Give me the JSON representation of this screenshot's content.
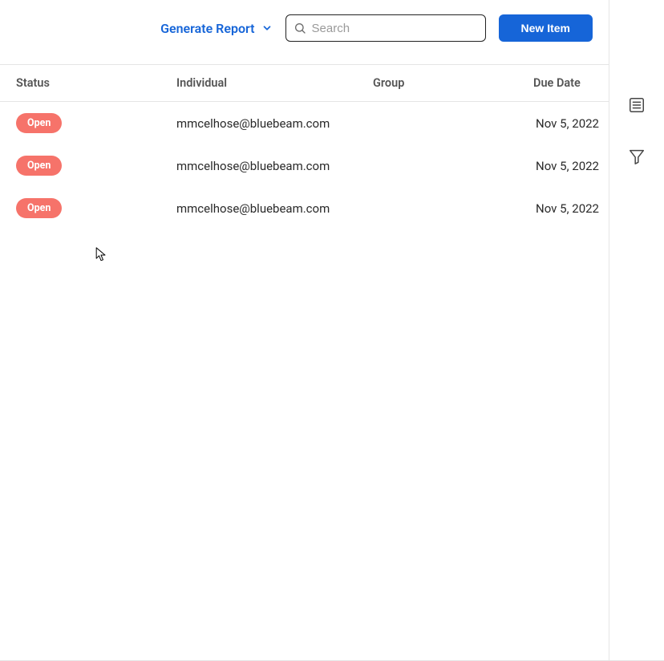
{
  "toolbar": {
    "generate_report_label": "Generate Report",
    "search_placeholder": "Search",
    "new_item_label": "New Item"
  },
  "columns": {
    "status": "Status",
    "individual": "Individual",
    "group": "Group",
    "due_date": "Due Date"
  },
  "rows": [
    {
      "status": "Open",
      "individual": "mmcelhose@bluebeam.com",
      "group": "",
      "due": "Nov 5, 2022"
    },
    {
      "status": "Open",
      "individual": "mmcelhose@bluebeam.com",
      "group": "",
      "due": "Nov 5, 2022"
    },
    {
      "status": "Open",
      "individual": "mmcelhose@bluebeam.com",
      "group": "",
      "due": "Nov 5, 2022"
    }
  ],
  "colors": {
    "accent": "#1665d8",
    "badge": "#f6736a"
  }
}
